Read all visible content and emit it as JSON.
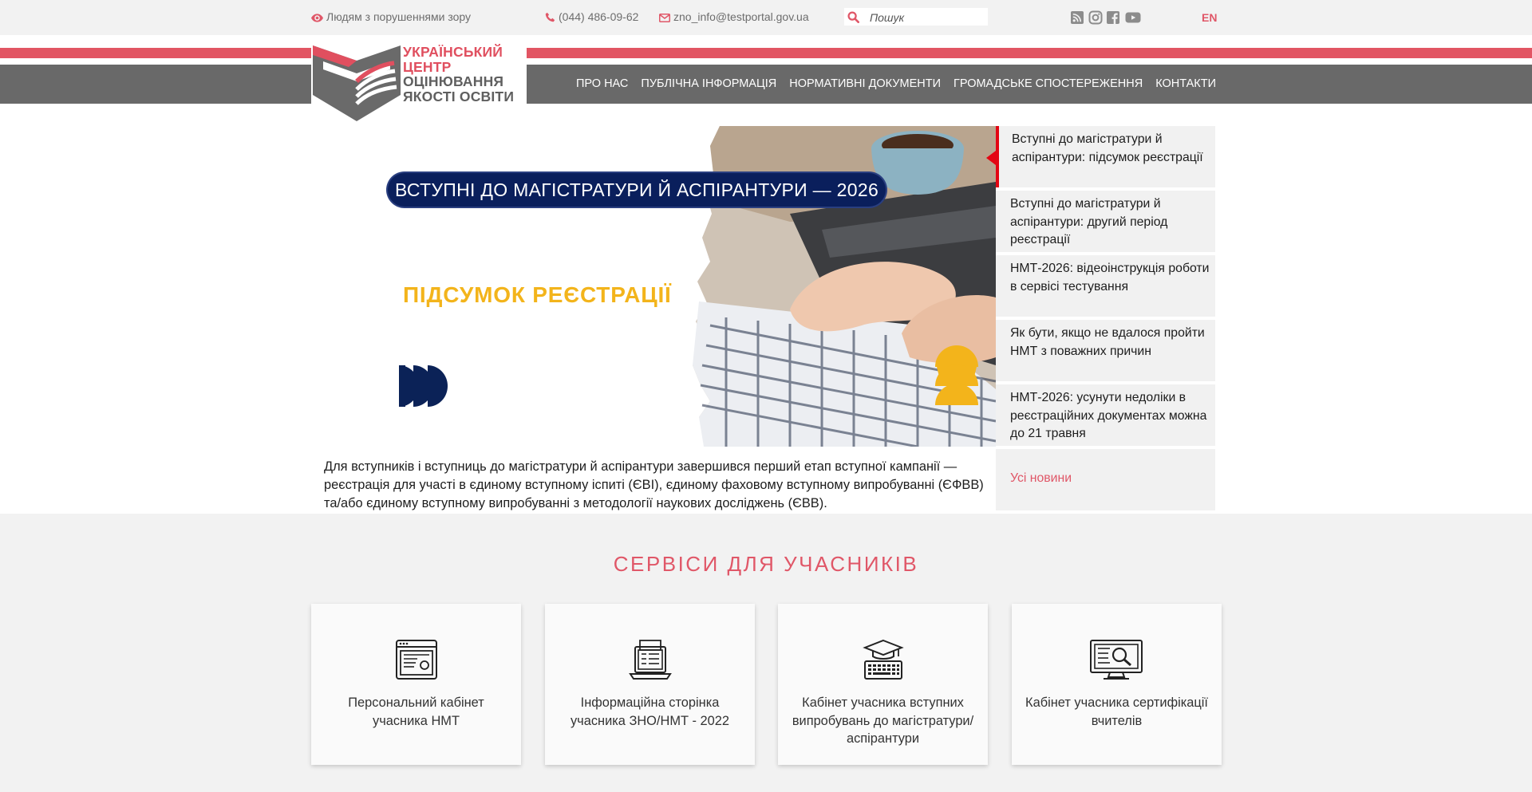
{
  "topbar": {
    "accessibility": "Людям з порушеннями зору",
    "phone": "(044) 486-09-62",
    "email": "zno_info@testportal.gov.ua",
    "search_placeholder": "Пошук",
    "social_icons": [
      "rss-icon",
      "instagram-icon",
      "facebook-icon",
      "youtube-icon"
    ],
    "language": "EN"
  },
  "logo": {
    "line1": "УКРАЇНСЬКИЙ",
    "line2": "ЦЕНТР",
    "line3": "ОЦІНЮВАННЯ",
    "line4": "ЯКОСТІ ОСВІТИ"
  },
  "nav": {
    "items": [
      "ПРО НАС",
      "ПУБЛІЧНА ІНФОРМАЦІЯ",
      "НОРМАТИВНІ ДОКУМЕНТИ",
      "ГРОМАДСЬКЕ СПОСТЕРЕЖЕННЯ",
      "КОНТАКТИ"
    ]
  },
  "slide": {
    "title": "ВСТУПНІ ДО МАГІСТРАТУРИ  Й АСПІРАНТУРИ — 2026",
    "subtitle": "ПІДСУМОК РЕЄСТРАЦІЇ"
  },
  "news": {
    "items": [
      "Вступні до магістратури й аспірантури: підсумок реєстрації",
      "Вступні до магістратури й аспірантури: другий період реєстрації",
      "НМТ-2026: відеоінструкція роботи в сервісі тестування",
      "Як бути, якщо не вдалося пройти НМТ з поважних причин",
      "НМТ-2026: усунути недоліки в реєстраційних документах можна до 21 травня"
    ],
    "all_link": "Усі новини"
  },
  "intro_text": "Для вступників і вступниць до магістратури й аспірантури завершився перший етап вступної кампанії — реєстрація для участі в єдиному вступному іспиті (ЄВІ), єдиному фаховому вступному випробуванні (ЄФВВ) та/або єдиному вступному випробуванні з методології наукових досліджень (ЄВВ).",
  "services": {
    "title": "СЕРВІСИ ДЛЯ УЧАСНИКІВ",
    "cards": [
      "Персональний кабінет учасника НМТ",
      "Інформаційна сторінка учасника ЗНО/НМТ - 2022",
      "Кабінет учасника вступних випробувань до магістратури/аспірантури",
      "Кабінет учасника сертифікації вчителів"
    ]
  },
  "colors": {
    "accent_red": "#e05768",
    "stripe_red": "#e25563",
    "header_gray": "#696969",
    "slide_navy": "#0a1f5c",
    "slide_yellow": "#f3b41b"
  }
}
